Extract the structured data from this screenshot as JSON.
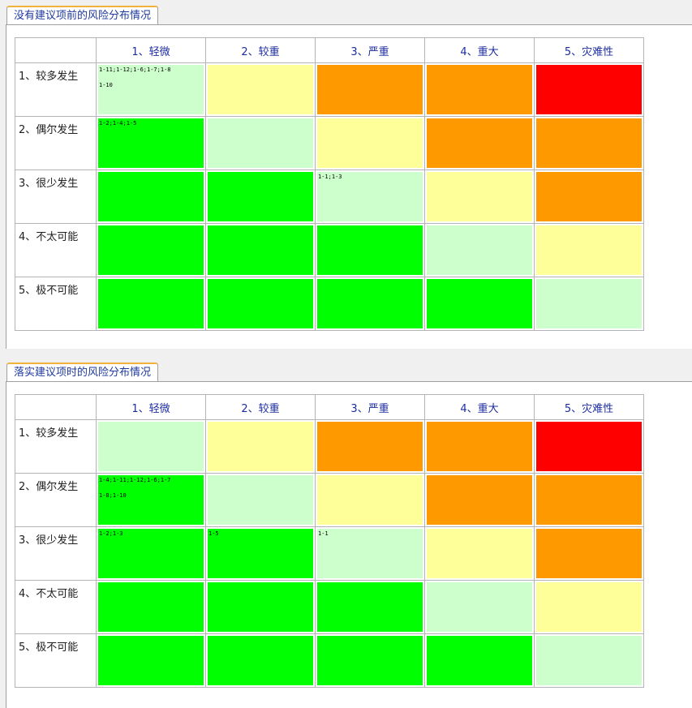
{
  "colors": {
    "light_green": "#ccffcc",
    "yellow": "#ffff99",
    "orange": "#ff9900",
    "red": "#ff0000",
    "green": "#00ff00"
  },
  "panels": [
    {
      "tab_label": "没有建议项前的风险分布情况",
      "columns": [
        "1、轻微",
        "2、较重",
        "3、严重",
        "4、重大",
        "5、灾难性"
      ],
      "rows": [
        {
          "label": "1、较多发生",
          "cells": [
            {
              "color": "light_green",
              "lines": [
                "1-11;1-12;1-6;1-7;1-8",
                "1-10"
              ]
            },
            {
              "color": "yellow",
              "lines": []
            },
            {
              "color": "orange",
              "lines": []
            },
            {
              "color": "orange",
              "lines": []
            },
            {
              "color": "red",
              "lines": []
            }
          ]
        },
        {
          "label": "2、偶尔发生",
          "cells": [
            {
              "color": "green",
              "lines": [
                "1-2;1-4;1-5"
              ]
            },
            {
              "color": "light_green",
              "lines": []
            },
            {
              "color": "yellow",
              "lines": []
            },
            {
              "color": "orange",
              "lines": []
            },
            {
              "color": "orange",
              "lines": []
            }
          ]
        },
        {
          "label": "3、很少发生",
          "cells": [
            {
              "color": "green",
              "lines": []
            },
            {
              "color": "green",
              "lines": []
            },
            {
              "color": "light_green",
              "lines": [
                "1-1;1-3"
              ]
            },
            {
              "color": "yellow",
              "lines": []
            },
            {
              "color": "orange",
              "lines": []
            }
          ]
        },
        {
          "label": "4、不太可能",
          "cells": [
            {
              "color": "green",
              "lines": []
            },
            {
              "color": "green",
              "lines": []
            },
            {
              "color": "green",
              "lines": []
            },
            {
              "color": "light_green",
              "lines": []
            },
            {
              "color": "yellow",
              "lines": []
            }
          ]
        },
        {
          "label": "5、极不可能",
          "cells": [
            {
              "color": "green",
              "lines": []
            },
            {
              "color": "green",
              "lines": []
            },
            {
              "color": "green",
              "lines": []
            },
            {
              "color": "green",
              "lines": []
            },
            {
              "color": "light_green",
              "lines": []
            }
          ]
        }
      ]
    },
    {
      "tab_label": "落实建议项时的风险分布情况",
      "columns": [
        "1、轻微",
        "2、较重",
        "3、严重",
        "4、重大",
        "5、灾难性"
      ],
      "rows": [
        {
          "label": "1、较多发生",
          "cells": [
            {
              "color": "light_green",
              "lines": []
            },
            {
              "color": "yellow",
              "lines": []
            },
            {
              "color": "orange",
              "lines": []
            },
            {
              "color": "orange",
              "lines": []
            },
            {
              "color": "red",
              "lines": []
            }
          ]
        },
        {
          "label": "2、偶尔发生",
          "cells": [
            {
              "color": "green",
              "lines": [
                "1-4;1-11;1-12;1-6;1-7",
                "1-8;1-10"
              ]
            },
            {
              "color": "light_green",
              "lines": []
            },
            {
              "color": "yellow",
              "lines": []
            },
            {
              "color": "orange",
              "lines": []
            },
            {
              "color": "orange",
              "lines": []
            }
          ]
        },
        {
          "label": "3、很少发生",
          "cells": [
            {
              "color": "green",
              "lines": [
                "1-2;1-3"
              ]
            },
            {
              "color": "green",
              "lines": [
                "1-5"
              ]
            },
            {
              "color": "light_green",
              "lines": [
                "1-1"
              ]
            },
            {
              "color": "yellow",
              "lines": []
            },
            {
              "color": "orange",
              "lines": []
            }
          ]
        },
        {
          "label": "4、不太可能",
          "cells": [
            {
              "color": "green",
              "lines": []
            },
            {
              "color": "green",
              "lines": []
            },
            {
              "color": "green",
              "lines": []
            },
            {
              "color": "light_green",
              "lines": []
            },
            {
              "color": "yellow",
              "lines": []
            }
          ]
        },
        {
          "label": "5、极不可能",
          "cells": [
            {
              "color": "green",
              "lines": []
            },
            {
              "color": "green",
              "lines": []
            },
            {
              "color": "green",
              "lines": []
            },
            {
              "color": "green",
              "lines": []
            },
            {
              "color": "light_green",
              "lines": []
            }
          ]
        }
      ]
    }
  ]
}
